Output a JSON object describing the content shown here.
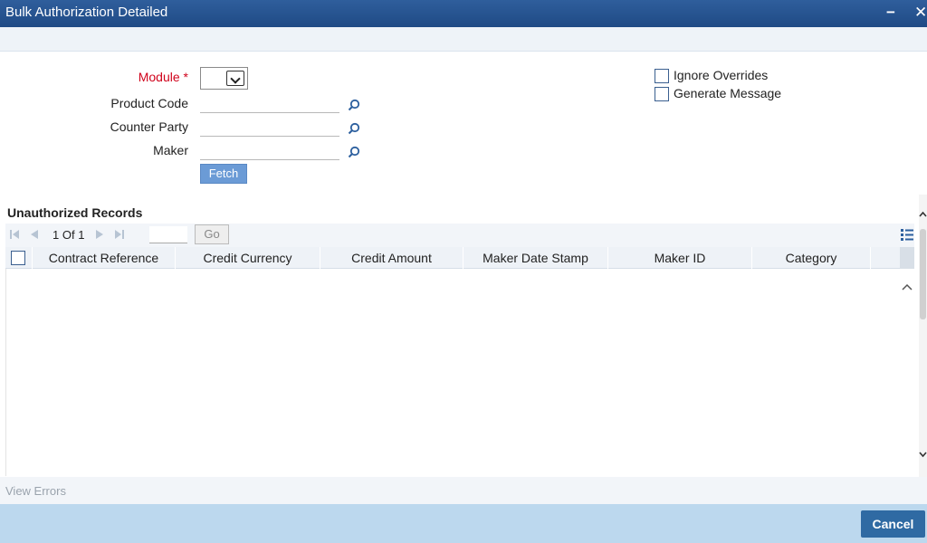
{
  "window": {
    "title": "Bulk Authorization Detailed",
    "minimize_symbol": "−",
    "close_symbol": "✕"
  },
  "form": {
    "module_label": "Module",
    "required_marker": "*",
    "module_value": "",
    "product_code_label": "Product Code",
    "product_code_value": "",
    "counter_party_label": "Counter Party",
    "counter_party_value": "",
    "maker_label": "Maker",
    "maker_value": "",
    "fetch_label": "Fetch",
    "ignore_overrides_label": "Ignore Overrides",
    "ignore_overrides_checked": false,
    "generate_message_label": "Generate Message",
    "generate_message_checked": false
  },
  "records": {
    "section_title": "Unauthorized Records",
    "page_current": "1",
    "page_of": "Of",
    "page_total": "1",
    "go_label": "Go",
    "columns": [
      "Contract Reference",
      "Credit Currency",
      "Credit Amount",
      "Maker Date Stamp",
      "Maker ID",
      "Category"
    ],
    "rows": []
  },
  "footer": {
    "view_errors_label": "View Errors",
    "cancel_label": "Cancel"
  },
  "colors": {
    "titlebar": "#1f4a85",
    "required": "#d0021b",
    "accent_button": "#2f6aa3",
    "footer_bg": "#bcd8ee"
  }
}
